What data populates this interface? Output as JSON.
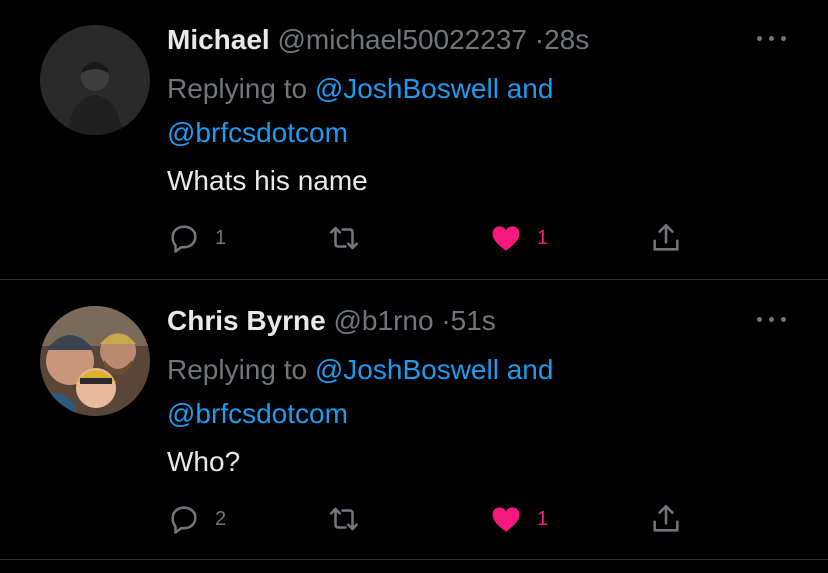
{
  "tweets": [
    {
      "name": "Michael",
      "handle": "@michael50022237",
      "separator": "·",
      "time": "28s",
      "replying_prefix": "Replying to",
      "mention_1": "@JoshBoswell",
      "and": "and",
      "mention_2": "@brfcsdotcom",
      "text": "Whats his name",
      "reply_count": "1",
      "retweet_count": "",
      "like_count": "1"
    },
    {
      "name": "Chris Byrne",
      "handle": "@b1rno",
      "separator": "·",
      "time": "51s",
      "replying_prefix": "Replying to",
      "mention_1": "@JoshBoswell",
      "and": "and",
      "mention_2": "@brfcsdotcom",
      "text": "Who?",
      "reply_count": "2",
      "retweet_count": "",
      "like_count": "1"
    }
  ],
  "icons": {
    "reply": "speech-bubble-icon",
    "retweet": "retweet-icon",
    "like": "heart-icon",
    "share": "share-icon",
    "more": "more-dots-icon"
  },
  "colors": {
    "background": "#000000",
    "text": "#e7e9ea",
    "muted": "#71767b",
    "link": "#1d9bf0",
    "like": "#f91880"
  }
}
